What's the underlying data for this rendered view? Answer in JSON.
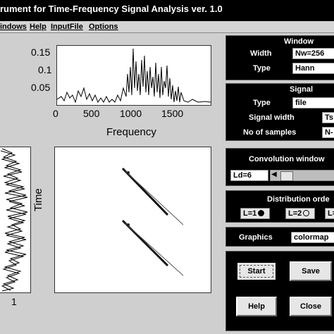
{
  "window": {
    "title": "rument for Time-Frequency Signal Analysis ver. 1.0"
  },
  "menu": [
    "indows",
    "Help",
    "InputFile",
    "Options"
  ],
  "spectrum_plot": {
    "ylabel_ticks": [
      "0.15",
      "0.1",
      "0.05"
    ],
    "xlabel_ticks": [
      "0",
      "500",
      "1000",
      "1500"
    ],
    "xlabel": "Frequency"
  },
  "time_signal_plot": {
    "x_tick": "1"
  },
  "tf_plot": {
    "ylabel": "Time"
  },
  "window_panel": {
    "title": "Window",
    "width_label": "Width",
    "width_value": "Nw=256",
    "type_label": "Type",
    "type_value": "Hann"
  },
  "signal_panel": {
    "title": "Signal",
    "type_label": "Type",
    "type_value": "file",
    "width_label": "Signal width",
    "width_value": "Ts",
    "samples_label": "No of samples",
    "samples_value": "N-"
  },
  "convolution_panel": {
    "title": "Convolution window",
    "value": "Ld=6"
  },
  "distribution_panel": {
    "title": "Distribution orde",
    "options": [
      "L=1",
      "L=2",
      "L="
    ]
  },
  "graphics_panel": {
    "label": "Graphics",
    "value": "colormap"
  },
  "buttons": {
    "start": "Start",
    "save": "Save",
    "help": "Help",
    "close": "Close"
  }
}
